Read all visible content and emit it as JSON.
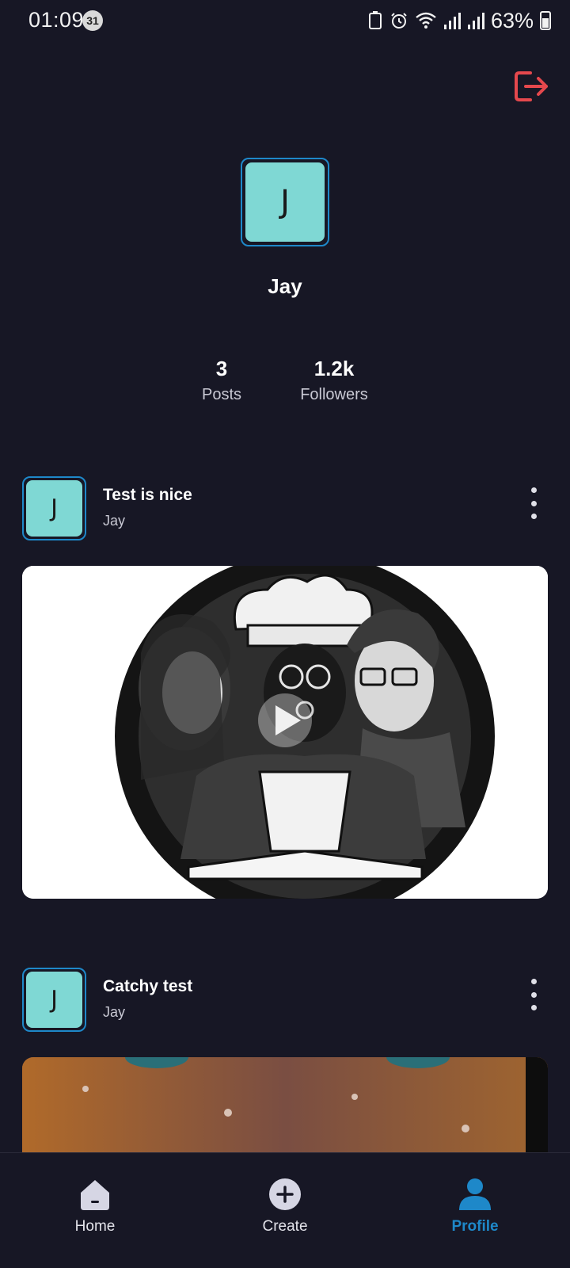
{
  "status_bar": {
    "time": "01:09",
    "badge": "31",
    "battery": "63%"
  },
  "profile": {
    "avatar_letter": "J",
    "name": "Jay",
    "stats": {
      "posts_value": "3",
      "posts_label": "Posts",
      "followers_value": "1.2k",
      "followers_label": "Followers"
    }
  },
  "posts": [
    {
      "avatar_letter": "J",
      "title": "Test is nice",
      "author": "Jay"
    },
    {
      "avatar_letter": "J",
      "title": "Catchy test",
      "author": "Jay"
    }
  ],
  "nav": {
    "home": "Home",
    "create": "Create",
    "profile": "Profile"
  },
  "colors": {
    "background": "#171725",
    "accent": "#1e88c9",
    "avatar_fill": "#7fd8d4",
    "logout": "#e5484d"
  },
  "icons": {
    "logout": "logout-icon",
    "menu": "more-vertical-icon",
    "play": "play-icon",
    "home": "home-icon",
    "create": "plus-circle-icon",
    "profile": "person-icon"
  }
}
